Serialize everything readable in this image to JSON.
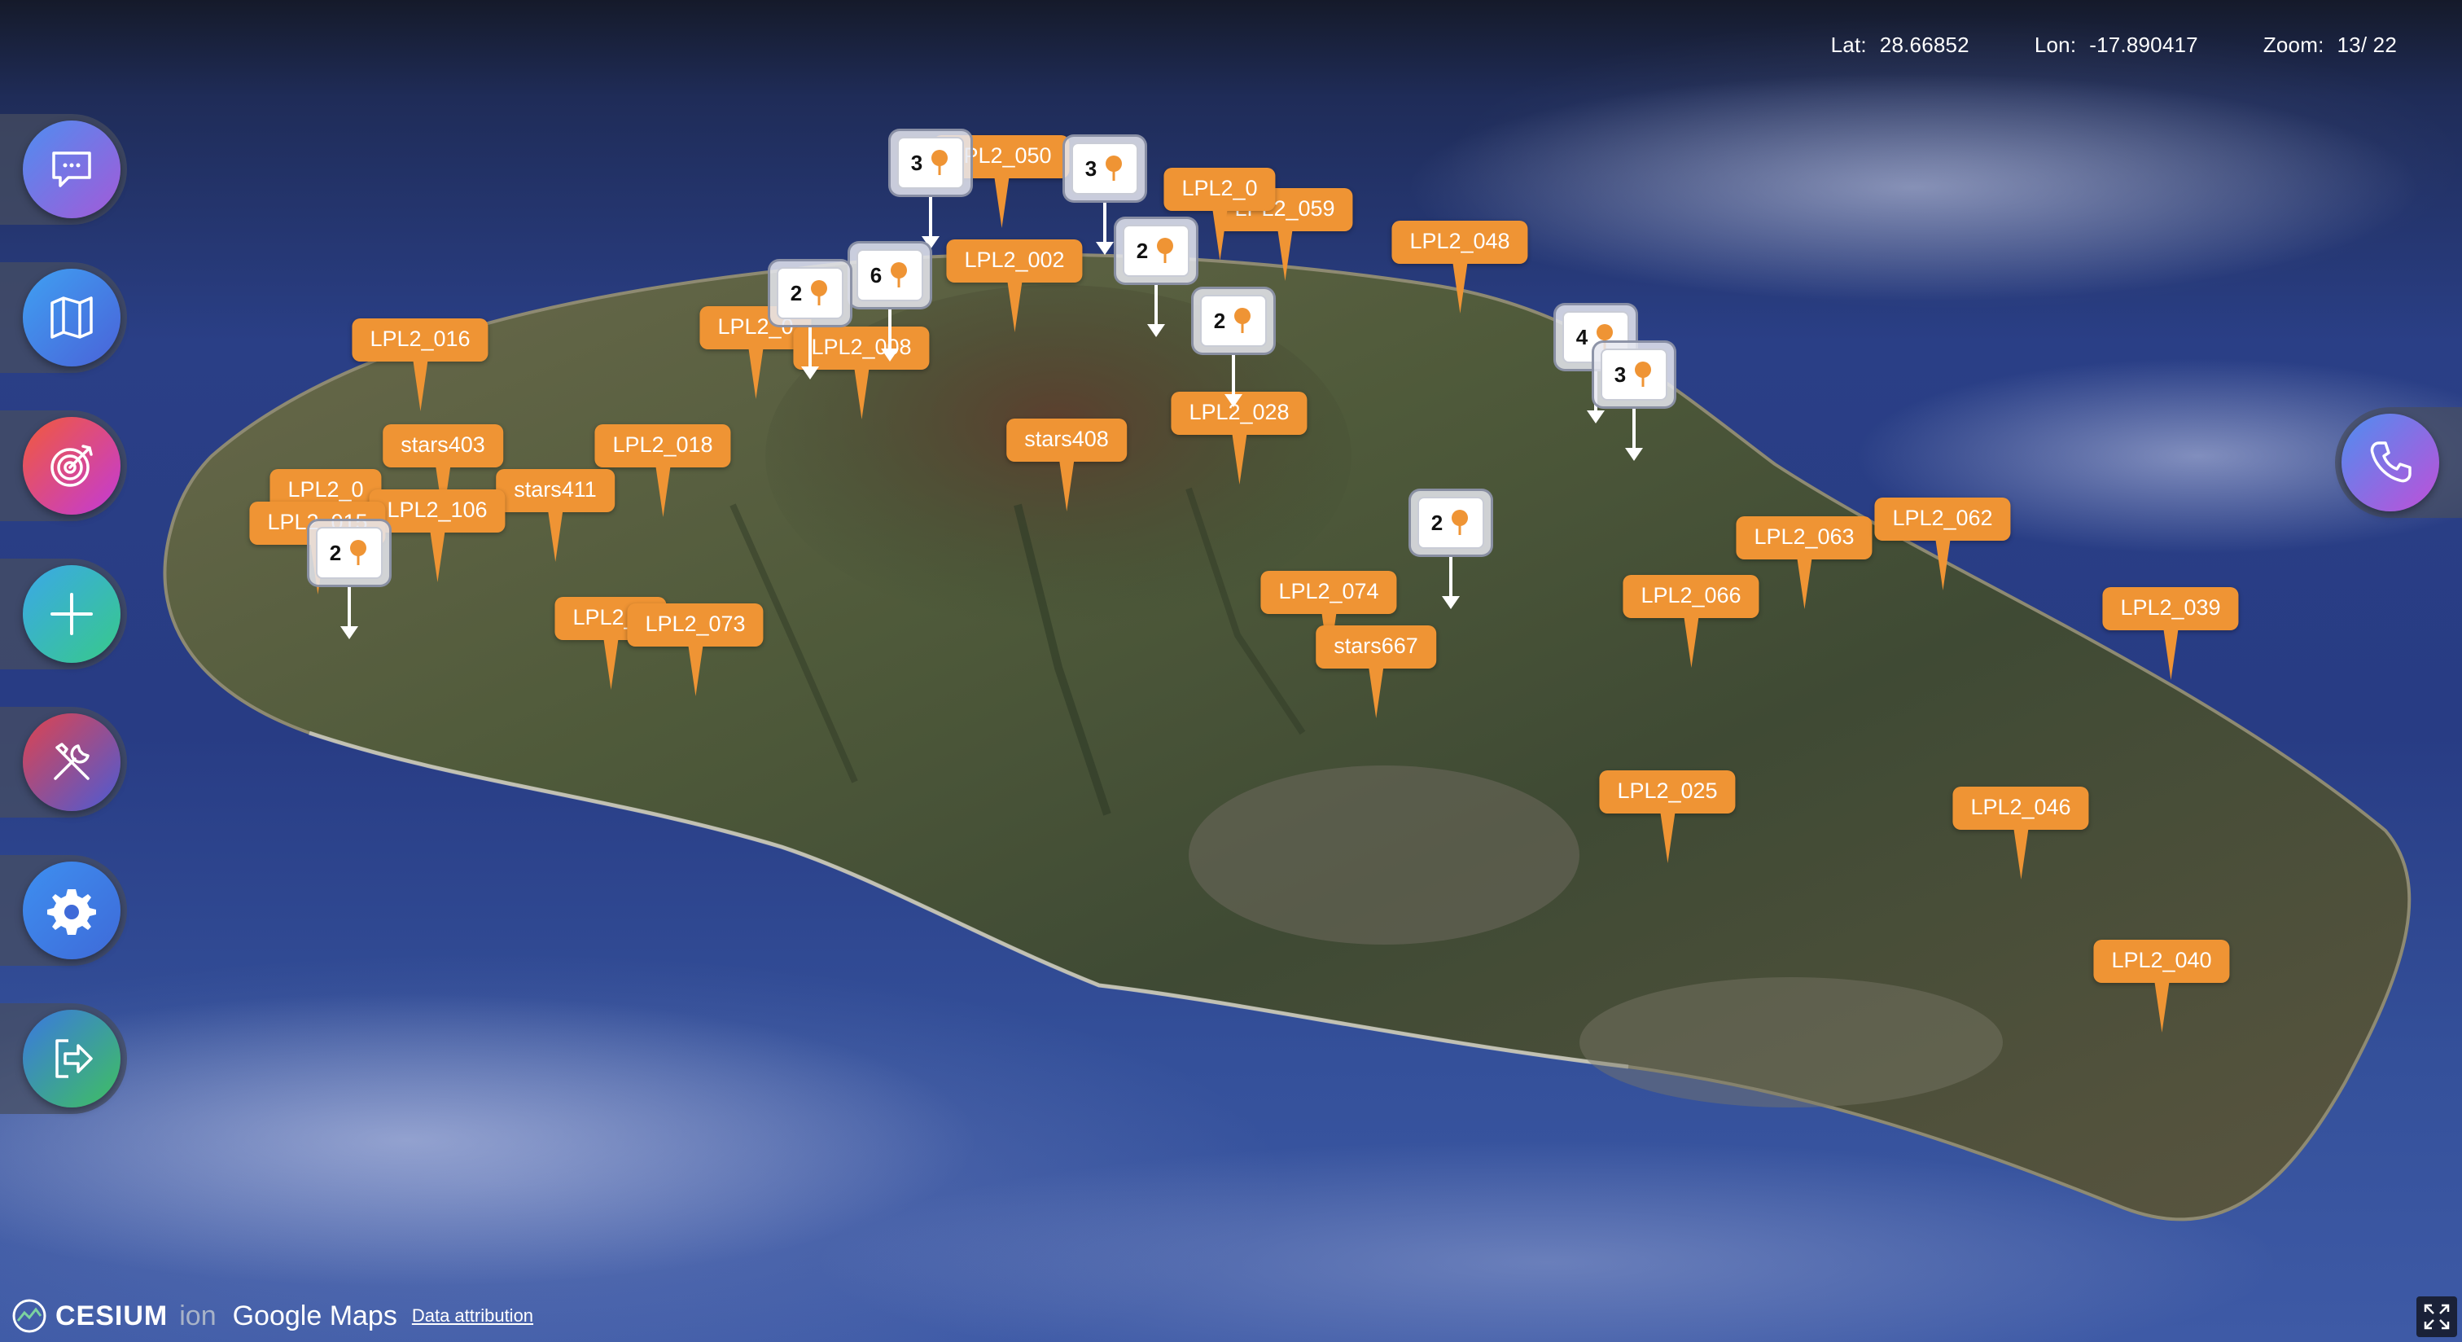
{
  "coords": {
    "lat_label": "Lat:",
    "lat_value": "28.66852",
    "lon_label": "Lon:",
    "lon_value": "-17.890417",
    "zoom_label": "Zoom:",
    "zoom_value": "13/ 22"
  },
  "sidebar": [
    {
      "name": "chat-button",
      "icon": "chat-bubble-icon",
      "gradient": [
        "#4f8df0",
        "#a35ad8"
      ]
    },
    {
      "name": "map-button",
      "icon": "map-icon",
      "gradient": [
        "#3fa0f2",
        "#4a62d8"
      ]
    },
    {
      "name": "target-button",
      "icon": "target-icon",
      "gradient": [
        "#f25a3a",
        "#c23ad8"
      ]
    },
    {
      "name": "add-button",
      "icon": "plus-icon",
      "gradient": [
        "#3aa8e8",
        "#38c98a"
      ]
    },
    {
      "name": "tools-button",
      "icon": "tools-icon",
      "gradient": [
        "#e0434d",
        "#4a5bd6"
      ]
    },
    {
      "name": "settings-button",
      "icon": "gear-icon",
      "gradient": [
        "#3d8ff0",
        "#3f6ad8"
      ]
    },
    {
      "name": "logout-button",
      "icon": "logout-icon",
      "gradient": [
        "#3a78e0",
        "#3fc060"
      ]
    }
  ],
  "phone_button": {
    "icon": "phone-icon",
    "gradient": [
      "#4e8ef0",
      "#c04fd8"
    ]
  },
  "markers": [
    {
      "label": "LPL2_050"
    },
    {
      "label": "LPL2_059"
    },
    {
      "label": "LPL2_0"
    },
    {
      "label": "LPL2_048"
    },
    {
      "label": "LPL2_002"
    },
    {
      "label": "LPL2_0"
    },
    {
      "label": "LPL2_008"
    },
    {
      "label": "LPL2_016"
    },
    {
      "label": "LPL2_028"
    },
    {
      "label": "stars408"
    },
    {
      "label": "stars403"
    },
    {
      "label": "LPL2_018"
    },
    {
      "label": "stars411"
    },
    {
      "label": "LPL2_0"
    },
    {
      "label": "LPL2_106"
    },
    {
      "label": "LPL2_015"
    },
    {
      "label": "LPL2_063"
    },
    {
      "label": "LPL2_062"
    },
    {
      "label": "LPL2_074"
    },
    {
      "label": "LPL2_066"
    },
    {
      "label": "LPL2_039"
    },
    {
      "label": "stars667"
    },
    {
      "label": "LPL2_0"
    },
    {
      "label": "LPL2_073"
    },
    {
      "label": "LPL2_025"
    },
    {
      "label": "LPL2_046"
    },
    {
      "label": "LPL2_040"
    }
  ],
  "clusters": [
    {
      "count": "3"
    },
    {
      "count": "3"
    },
    {
      "count": "6"
    },
    {
      "count": "2"
    },
    {
      "count": "2"
    },
    {
      "count": "2"
    },
    {
      "count": "4"
    },
    {
      "count": "3"
    },
    {
      "count": "2"
    },
    {
      "count": "2"
    }
  ],
  "footer": {
    "cesium": "CESIUM",
    "ion": "ion",
    "google": "Google Maps",
    "attribution": "Data attribution"
  },
  "colors": {
    "marker": "#ef9434",
    "ocean": "#2a3f86",
    "terrain": "#4a5a3a"
  }
}
